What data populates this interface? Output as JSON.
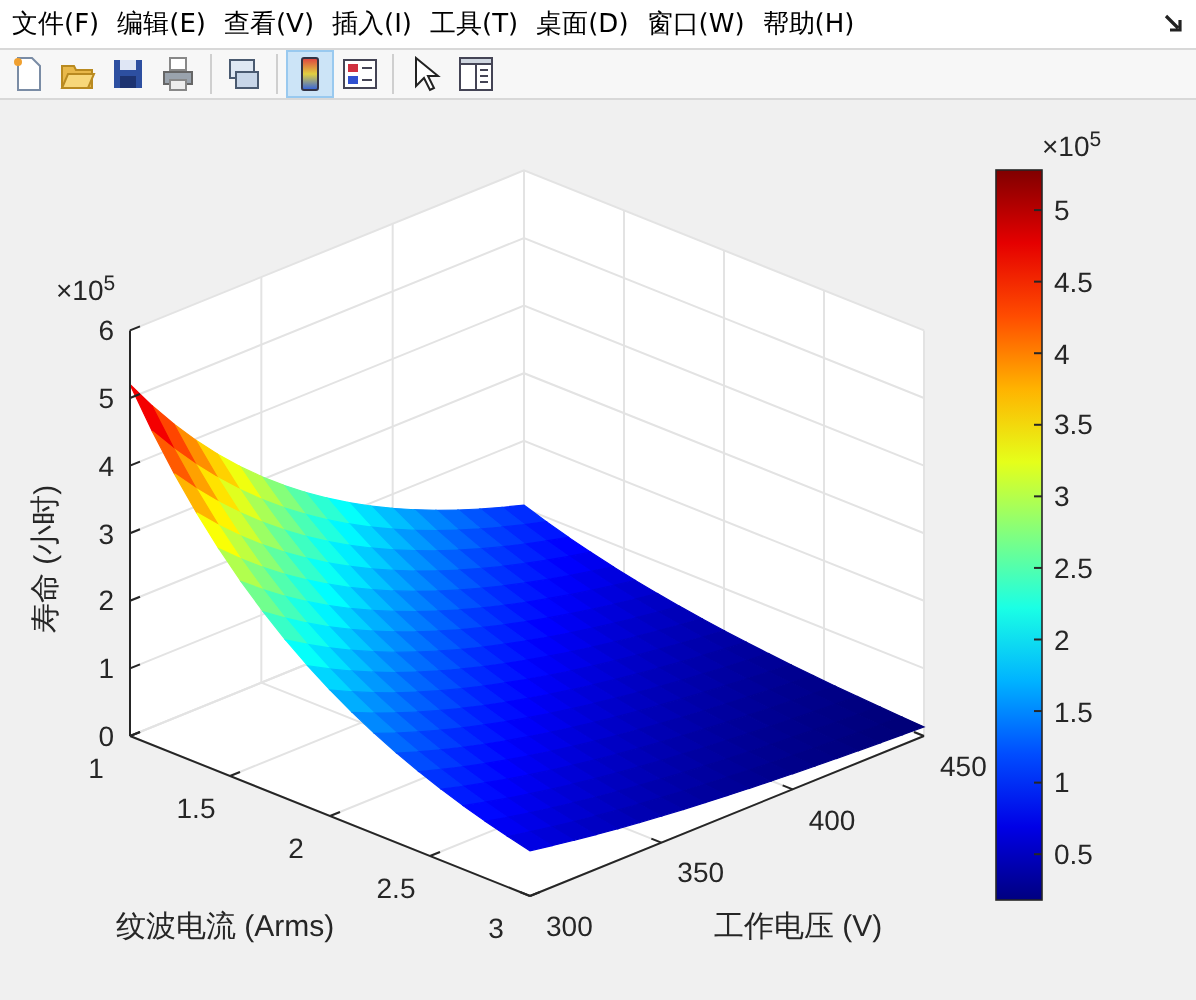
{
  "menu": [
    "文件(F)",
    "编辑(E)",
    "查看(V)",
    "插入(I)",
    "工具(T)",
    "桌面(D)",
    "窗口(W)",
    "帮助(H)"
  ],
  "toolbar": [
    {
      "kind": "new",
      "selected": false
    },
    {
      "kind": "open",
      "selected": false
    },
    {
      "kind": "save",
      "selected": false
    },
    {
      "kind": "print",
      "selected": false
    },
    {
      "kind": "link",
      "selected": false
    },
    {
      "kind": "colorbar",
      "selected": true
    },
    {
      "kind": "legend",
      "selected": false
    },
    {
      "kind": "pointer",
      "selected": false
    },
    {
      "kind": "panel",
      "selected": false
    }
  ],
  "figure": {
    "z_axis": {
      "label": "寿命 (小时)",
      "multiplier": "×10$^{5}$",
      "ticks": [
        "6",
        "5",
        "4",
        "3",
        "2",
        "1",
        "0"
      ]
    },
    "x_axis": {
      "label": "纹波电流 (Arms)",
      "ticks": [
        "1",
        "1.5",
        "2",
        "2.5",
        "3"
      ]
    },
    "y_axis": {
      "label": "工作电压 (V)",
      "ticks": [
        "300",
        "350",
        "400",
        "450"
      ]
    },
    "colorbar": {
      "multiplier": "×10$^{5}$",
      "ticks": [
        "5",
        "4.5",
        "4",
        "3.5",
        "3",
        "2.5",
        "2",
        "1.5",
        "1",
        "0.5"
      ]
    }
  }
}
